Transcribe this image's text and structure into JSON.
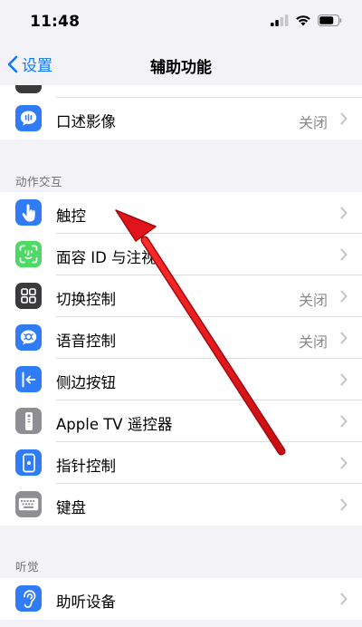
{
  "status": {
    "time": "11:48"
  },
  "nav": {
    "back_label": "设置",
    "title": "辅助功能"
  },
  "rows": {
    "spoken_content": {
      "label": "口述影像",
      "value": "关闭"
    },
    "touch": {
      "label": "触控"
    },
    "face_id": {
      "label": "面容 ID 与注视"
    },
    "switch_control": {
      "label": "切换控制",
      "value": "关闭"
    },
    "voice_control": {
      "label": "语音控制",
      "value": "关闭"
    },
    "side_button": {
      "label": "侧边按钮"
    },
    "apple_tv_remote": {
      "label": "Apple TV 遥控器"
    },
    "pointer_control": {
      "label": "指针控制"
    },
    "keyboard": {
      "label": "键盘"
    },
    "hearing_devices": {
      "label": "助听设备"
    }
  },
  "sections": {
    "interaction": "动作交互",
    "hearing": "听觉"
  },
  "colors": {
    "accent": "#0a7aff",
    "annotation_arrow": "#e0141a"
  },
  "icons": {
    "spoken_content": "speech-bubble-icon",
    "touch": "hand-tap-icon",
    "face_id": "face-id-icon",
    "switch_control": "grid-icon",
    "voice_control": "voice-wave-icon",
    "side_button": "side-button-icon",
    "apple_tv_remote": "remote-icon",
    "pointer_control": "pointer-icon",
    "keyboard": "keyboard-icon",
    "hearing_devices": "ear-icon"
  }
}
